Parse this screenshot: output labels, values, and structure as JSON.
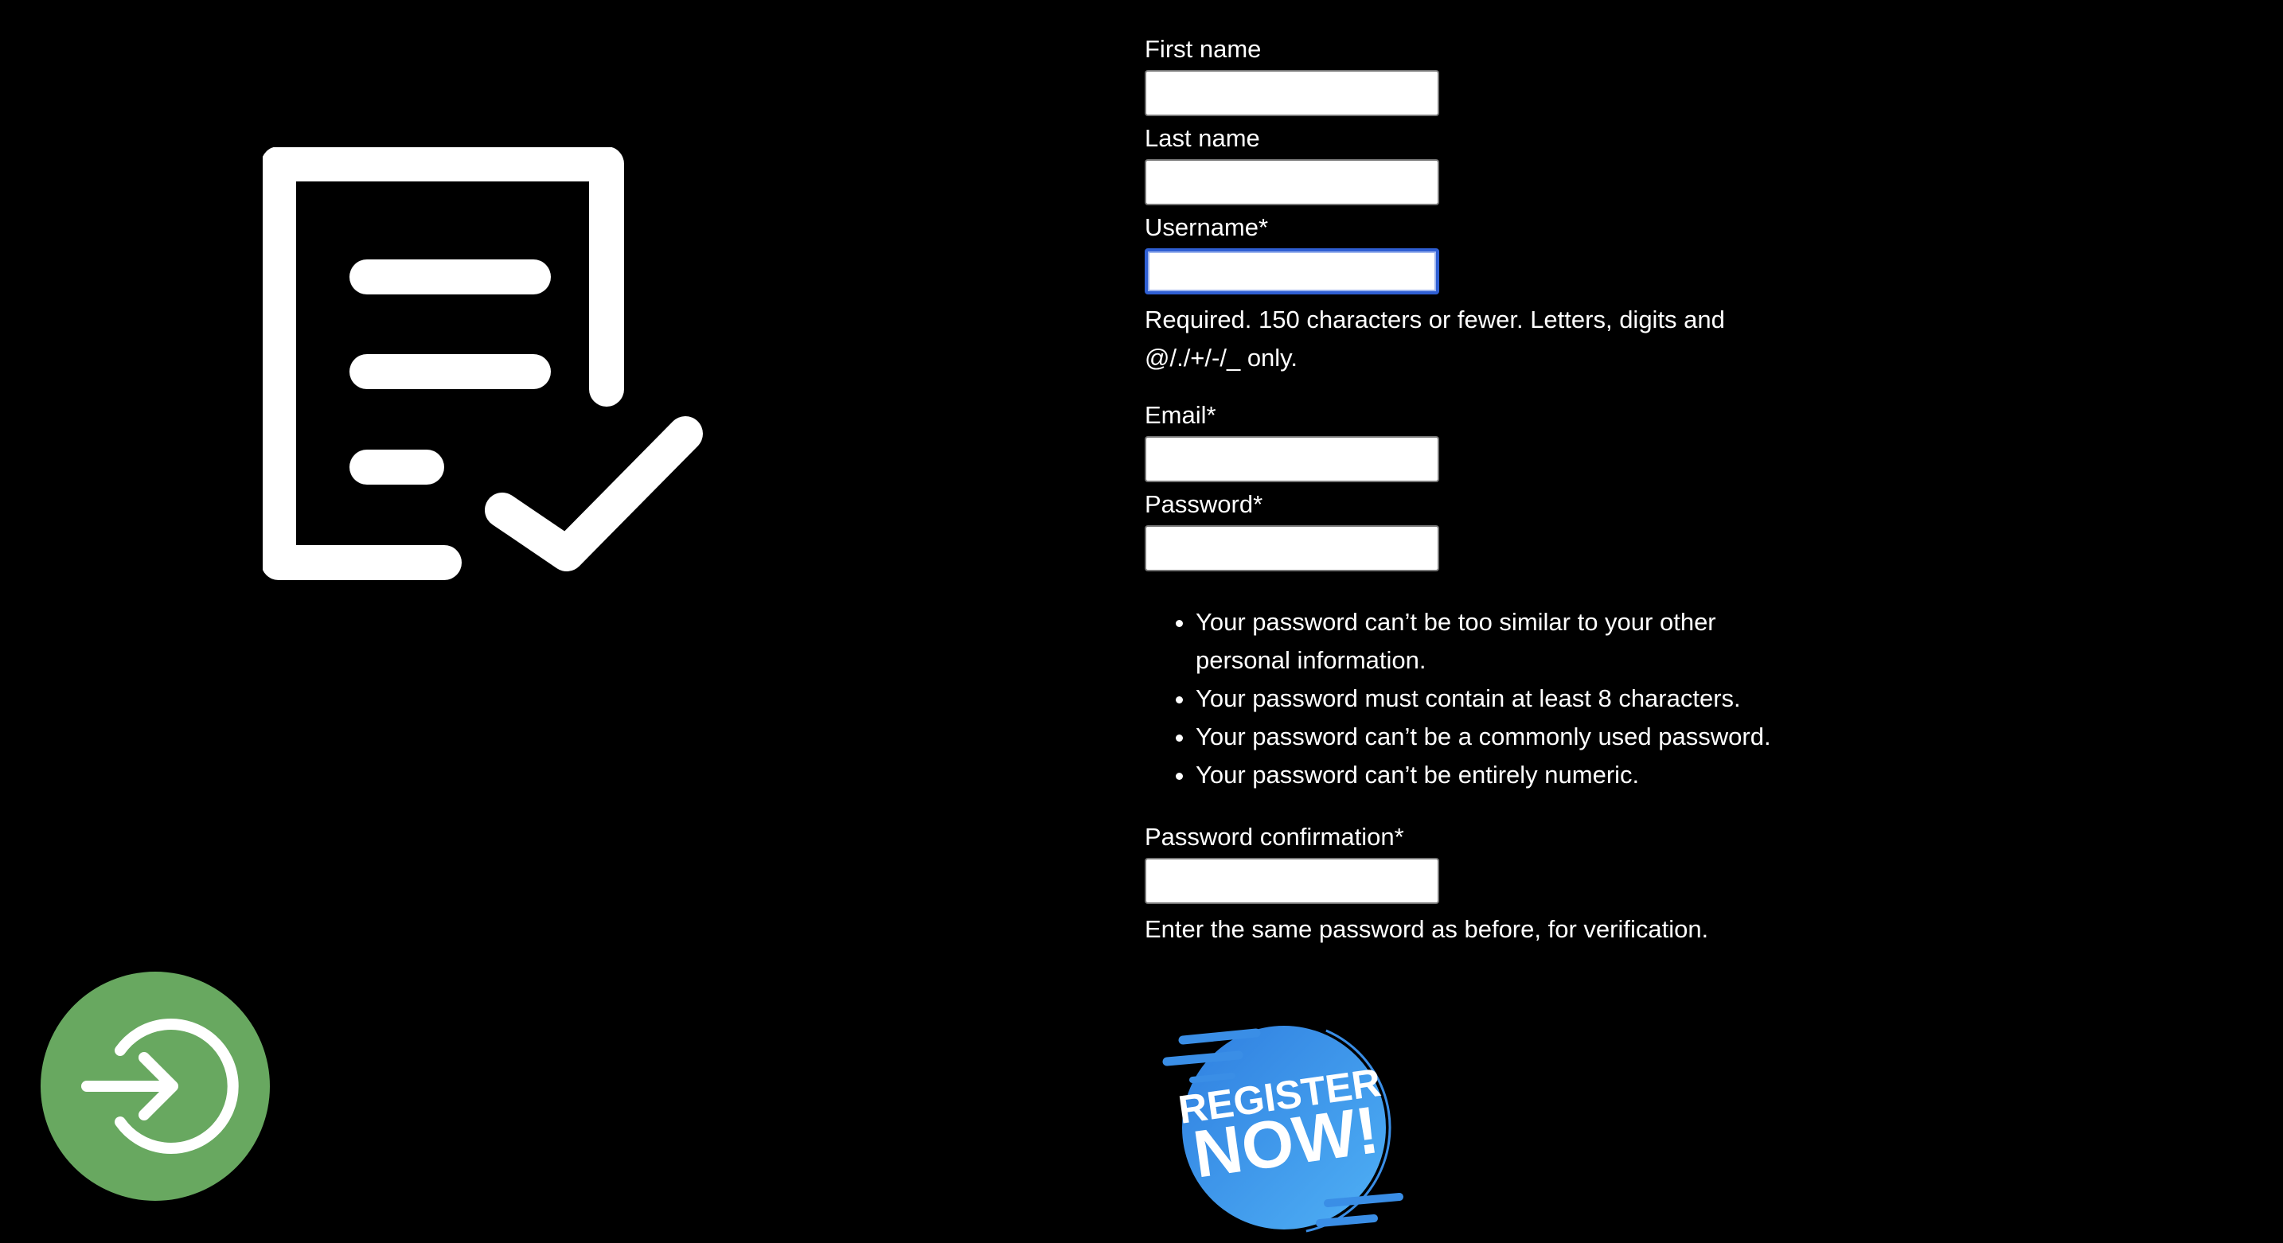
{
  "hero": {
    "icon": "document-checklist-icon"
  },
  "form": {
    "first_name": {
      "label": "First name",
      "value": ""
    },
    "last_name": {
      "label": "Last name",
      "value": ""
    },
    "username": {
      "label": "Username*",
      "value": "",
      "help": "Required. 150 characters or fewer. Letters, digits and @/./+/-/_ only."
    },
    "email": {
      "label": "Email*",
      "value": ""
    },
    "password": {
      "label": "Password*",
      "value": "",
      "rules": [
        "Your password can’t be too similar to your other personal information.",
        "Your password must contain at least 8 characters.",
        "Your password can’t be a commonly used password.",
        "Your password can’t be entirely numeric."
      ]
    },
    "password_confirmation": {
      "label": "Password confirmation*",
      "value": "",
      "help": "Enter the same password as before, for verification."
    }
  },
  "register_badge": {
    "line1": "REGISTER",
    "line2": "NOW!"
  },
  "login_button": {
    "icon": "login-arrow-icon"
  },
  "colors": {
    "background": "#000000",
    "text": "#ffffff",
    "login_green": "#68a860",
    "badge_blue": "#3a8ee6",
    "focus_blue": "#2f5fd3"
  }
}
